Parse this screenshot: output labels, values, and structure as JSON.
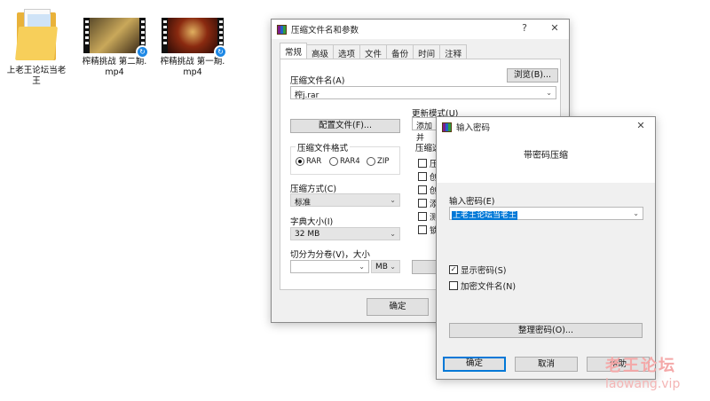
{
  "desktop": {
    "items": [
      {
        "label": "上老王论坛当老王",
        "type": "folder"
      },
      {
        "label": "榨精挑战 第二期.mp4",
        "type": "video"
      },
      {
        "label": "榨精挑战 第一期.mp4",
        "type": "video"
      }
    ]
  },
  "archive_dialog": {
    "title": "压缩文件名和参数",
    "help": "?",
    "close": "✕",
    "tabs": [
      "常规",
      "高级",
      "选项",
      "文件",
      "备份",
      "时间",
      "注释"
    ],
    "archive_name_label": "压缩文件名(A)",
    "archive_name_value": "榨j.rar",
    "browse_button": "浏览(B)...",
    "profiles_button": "配置文件(F)...",
    "update_mode_label": "更新模式(U)",
    "update_mode_value": "添加并",
    "format_group": "压缩文件格式",
    "formats": [
      "RAR",
      "RAR4",
      "ZIP"
    ],
    "method_label": "压缩方式(C)",
    "method_value": "标准",
    "dict_label": "字典大小(I)",
    "dict_value": "32 MB",
    "split_label": "切分为分卷(V)，大小",
    "split_unit": "MB",
    "options_group": "压缩选",
    "options_partial": [
      "压",
      "创",
      "创",
      "添",
      "测",
      "锁"
    ],
    "ok_button": "确定"
  },
  "password_dialog": {
    "title": "输入密码",
    "close": "✕",
    "heading": "带密码压缩",
    "password_label": "输入密码(E)",
    "password_value": "上老王论坛当老王",
    "show_password_label": "显示密码(S)",
    "show_password_checked": true,
    "encrypt_names_label": "加密文件名(N)",
    "encrypt_names_checked": false,
    "organize_button": "整理密码(O)...",
    "ok_button": "确定",
    "cancel_button": "取消",
    "help_button": "帮助"
  },
  "watermark": {
    "cn": "老王论坛",
    "en": "laowang.vip"
  }
}
